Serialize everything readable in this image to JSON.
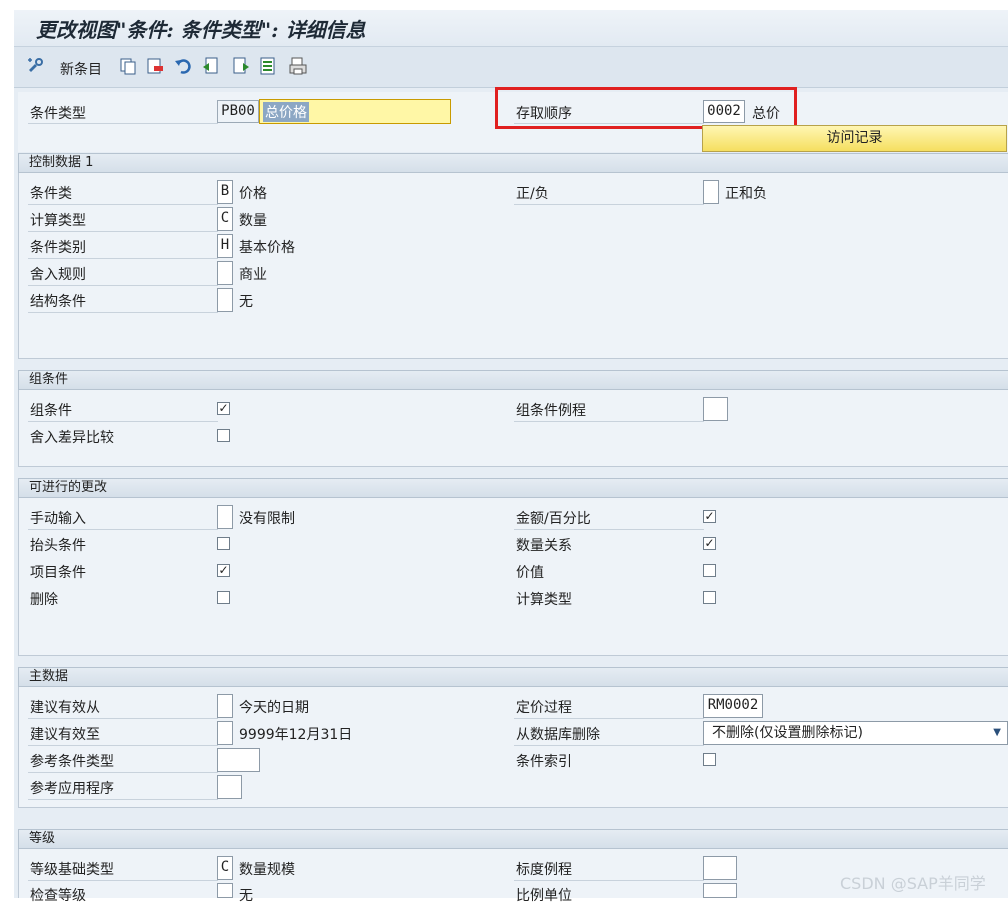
{
  "window": {
    "title": "更改视图\"条件: 条件类型\": 详细信息"
  },
  "toolbar": {
    "new_entries_label": "新条目"
  },
  "header": {
    "condition_type_label": "条件类型",
    "condition_type_code": "PB00",
    "condition_type_desc": "总价格",
    "access_sequence_label": "存取顺序",
    "access_sequence_code": "0002",
    "access_sequence_desc": "总价",
    "access_records_button": "访问记录"
  },
  "control_data": {
    "title": "控制数据 1",
    "rows": [
      {
        "label": "条件类",
        "code": "B",
        "desc": "价格"
      },
      {
        "label": "计算类型",
        "code": "C",
        "desc": "数量"
      },
      {
        "label": "条件类别",
        "code": "H",
        "desc": "基本价格"
      },
      {
        "label": "舍入规则",
        "code": "",
        "desc": "商业"
      },
      {
        "label": "结构条件",
        "code": "",
        "desc": "无"
      }
    ],
    "plus_minus_label": "正/负",
    "plus_minus_code": "",
    "plus_minus_desc": "正和负"
  },
  "group_condition": {
    "title": "组条件",
    "group_cond_label": "组条件",
    "group_cond_checked": "✓",
    "rounding_diff_label": "舍入差异比较",
    "rounding_diff_checked": "",
    "routine_label": "组条件例程",
    "routine_value": ""
  },
  "changes": {
    "title": "可进行的更改",
    "manual_label": "手动输入",
    "manual_code": "",
    "manual_desc": "没有限制",
    "header_cond_label": "抬头条件",
    "header_cond_checked": "",
    "item_cond_label": "项目条件",
    "item_cond_checked": "✓",
    "delete_label": "删除",
    "delete_checked": "",
    "amount_pct_label": "金额/百分比",
    "amount_pct_checked": "✓",
    "qty_rel_label": "数量关系",
    "qty_rel_checked": "✓",
    "value_label": "价值",
    "value_checked": "",
    "calc_type_label": "计算类型",
    "calc_type_checked": ""
  },
  "master_data": {
    "title": "主数据",
    "valid_from_label": "建议有效从",
    "valid_from_code": "",
    "valid_from_desc": "今天的日期",
    "valid_to_label": "建议有效至",
    "valid_to_code": "",
    "valid_to_desc": "9999年12月31日",
    "ref_cond_type_label": "参考条件类型",
    "ref_cond_type_value": "",
    "ref_app_label": "参考应用程序",
    "ref_app_value": "",
    "pricing_proc_label": "定价过程",
    "pricing_proc_value": "RM0002",
    "delete_db_label": "从数据库删除",
    "delete_db_value": "不删除(仅设置删除标记)",
    "cond_index_label": "条件索引",
    "cond_index_checked": ""
  },
  "scales": {
    "title": "等级",
    "basis_label": "等级基础类型",
    "basis_code": "C",
    "basis_desc": "数量规模",
    "check_label": "检查等级",
    "check_code": "",
    "check_desc": "无",
    "routine_label": "标度例程",
    "routine_value": "",
    "unit_label": "比例单位",
    "unit_value": ""
  },
  "watermark": "CSDN @SAP羊同学",
  "colors": {
    "highlight_box": "#e02020",
    "button_yellow": "#f5df60",
    "panel_blue": "#eef3f8"
  }
}
